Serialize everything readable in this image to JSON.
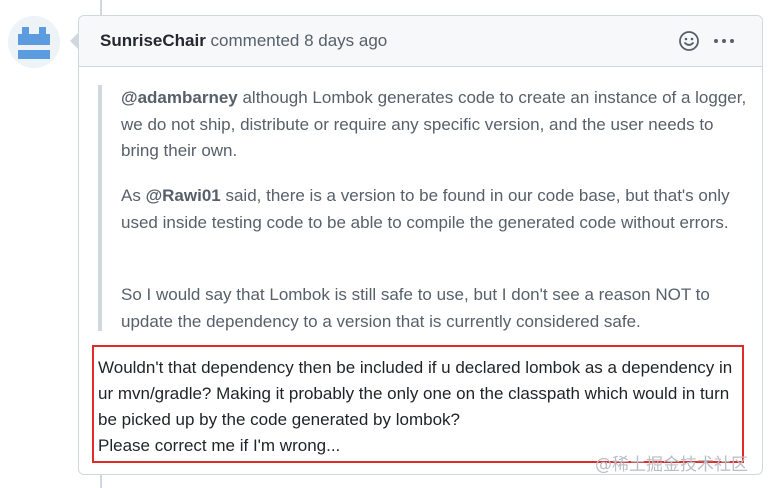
{
  "comment": {
    "author": "SunriseChair",
    "meta": "commented 8 days ago",
    "quote": {
      "p1_mention": "@adambarney",
      "p1_text": " although Lombok generates code to create an instance of a logger, we do not ship, distribute or require any specific version, and the user needs to bring their own.",
      "p2_prefix": "As ",
      "p2_mention": "@Rawi01",
      "p2_text": " said, there is a version to be found in our code base, but that's only used inside testing code to be able to compile the generated code without errors.",
      "p3_text": "So I would say that Lombok is still safe to use, but I don't see a reason NOT to update the dependency to a version that is currently considered safe."
    },
    "reply_line1": "Wouldn't that dependency then be included if u declared lombok as a dependency in ur mvn/gradle? Making it probably the only one on the classpath which would in turn be picked up by the code generated by lombok?",
    "reply_line2": "Please correct me if I'm wrong..."
  },
  "icons": {
    "avatar": "avatar-identicon",
    "emoji": "smiley-icon",
    "more": "kebab-horizontal-icon"
  },
  "watermark": "@稀土掘金技术社区",
  "colors": {
    "highlight_border": "#e12b28",
    "header_bg": "#f6f8fa",
    "avatar_fill": "#4f8fd6"
  }
}
